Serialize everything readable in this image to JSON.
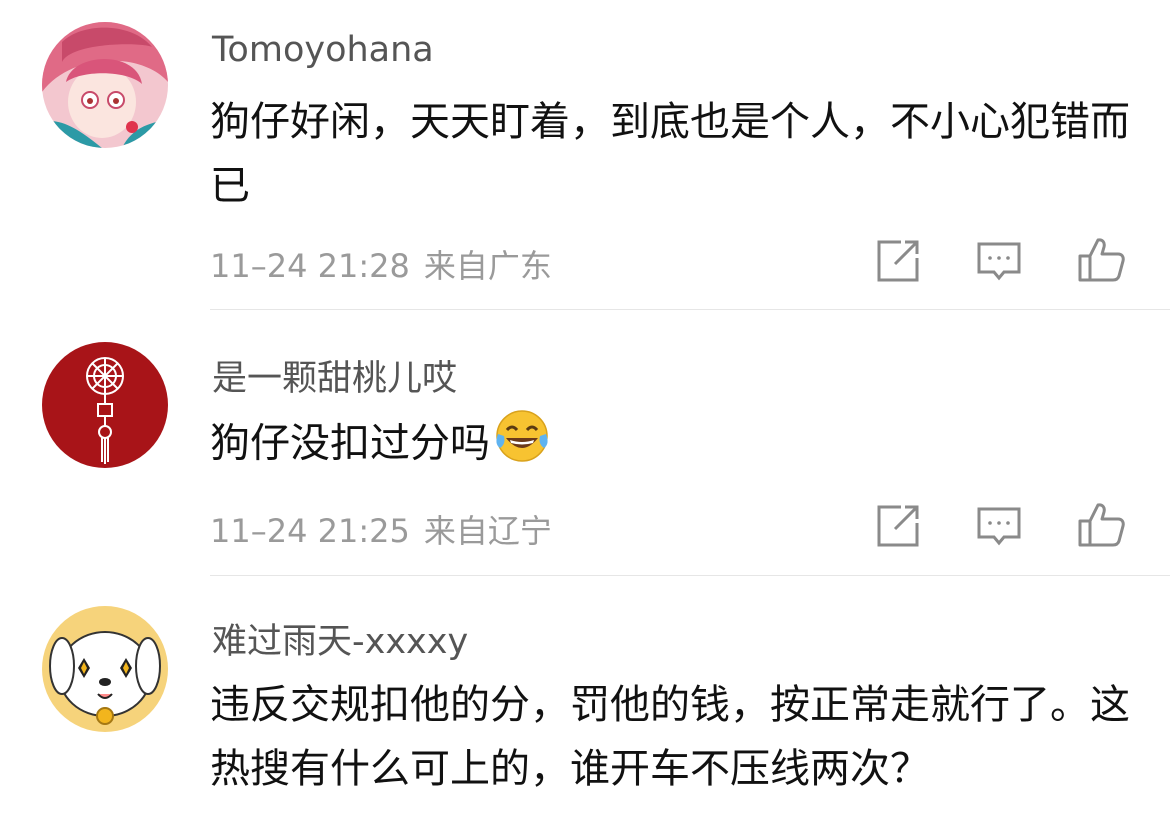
{
  "comments": [
    {
      "username": "Tomoyohana",
      "text": "狗仔好闲，天天盯着，到底也是个人，不小心犯错而已",
      "time": "11–24 21:28",
      "location": "来自广东",
      "avatar": "anime-girl-avatar"
    },
    {
      "username": "是一颗甜桃儿哎",
      "text": "狗仔没扣过分吗",
      "emoji": "tears-of-joy-emoji",
      "time": "11–24 21:25",
      "location": "来自辽宁",
      "avatar": "red-chinese-knot-avatar"
    },
    {
      "username": "难过雨天-xxxxy",
      "text": "违反交规扣他的分，罚他的钱，按正常走就行了。这热搜有什么可上的，谁开车不压线两次？",
      "avatar": "white-puppy-avatar"
    }
  ],
  "actions": [
    "share-icon",
    "comment-icon",
    "like-icon"
  ],
  "colors": {
    "username": "#555555",
    "text": "#111111",
    "meta": "#9a9a9a",
    "icon": "#8a8a8a",
    "divider": "#e6e6e6"
  }
}
